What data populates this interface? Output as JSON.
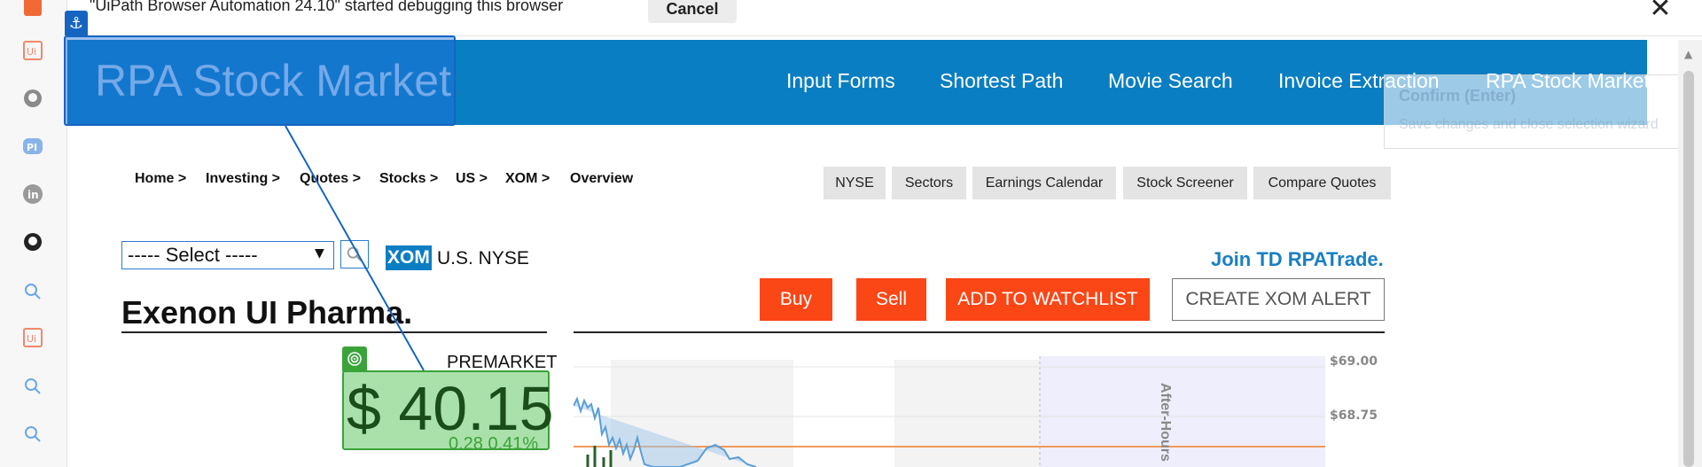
{
  "debug_bar": {
    "message": "\"UiPath Browser Automation 24.10\" started debugging this browser",
    "cancel_label": "Cancel"
  },
  "rail_icons": [
    "uipath-assistant-icon",
    "uipath-icon",
    "github-icon",
    "pi-icon",
    "linkedin-icon",
    "github-icon",
    "search-icon",
    "uipath-icon",
    "search-icon",
    "search-icon"
  ],
  "header": {
    "brand": "RPA Stock Market",
    "nav": [
      "Input Forms",
      "Shortest Path",
      "Movie Search",
      "Invoice Extraction",
      "RPA Stock Market"
    ]
  },
  "confirm_tooltip": {
    "title": "Confirm (Enter)",
    "subtitle": "Save changes and close selection wizard"
  },
  "breadcrumb": [
    "Home >",
    "Investing >",
    "Quotes >",
    "Stocks >",
    "US >",
    "XOM >",
    "Overview"
  ],
  "tags": [
    "NYSE",
    "Sectors",
    "Earnings Calendar",
    "Stock Screener",
    "Compare Quotes"
  ],
  "select": {
    "value": "----- Select -----"
  },
  "ticker": {
    "symbol": "XOM",
    "exchange": "U.S. NYSE"
  },
  "join_link": "Join TD RPATrade.",
  "actions": {
    "buy": "Buy",
    "sell": "Sell",
    "watch": "ADD TO WATCHLIST",
    "alert": "CREATE XOM ALERT"
  },
  "company": {
    "name": "Exenon UI Pharma."
  },
  "quote": {
    "session": "PREMARKET",
    "price": "$ 40.15",
    "change": "0.28 0.41%"
  },
  "chart": {
    "y_ticks": [
      "$69.00",
      "$68.75"
    ],
    "after_hours_label": "After-Hours"
  },
  "colors": {
    "brand_blue": "#0a7ec2",
    "action_orange": "#fb4616",
    "highlight_green": "#3aa33a"
  }
}
